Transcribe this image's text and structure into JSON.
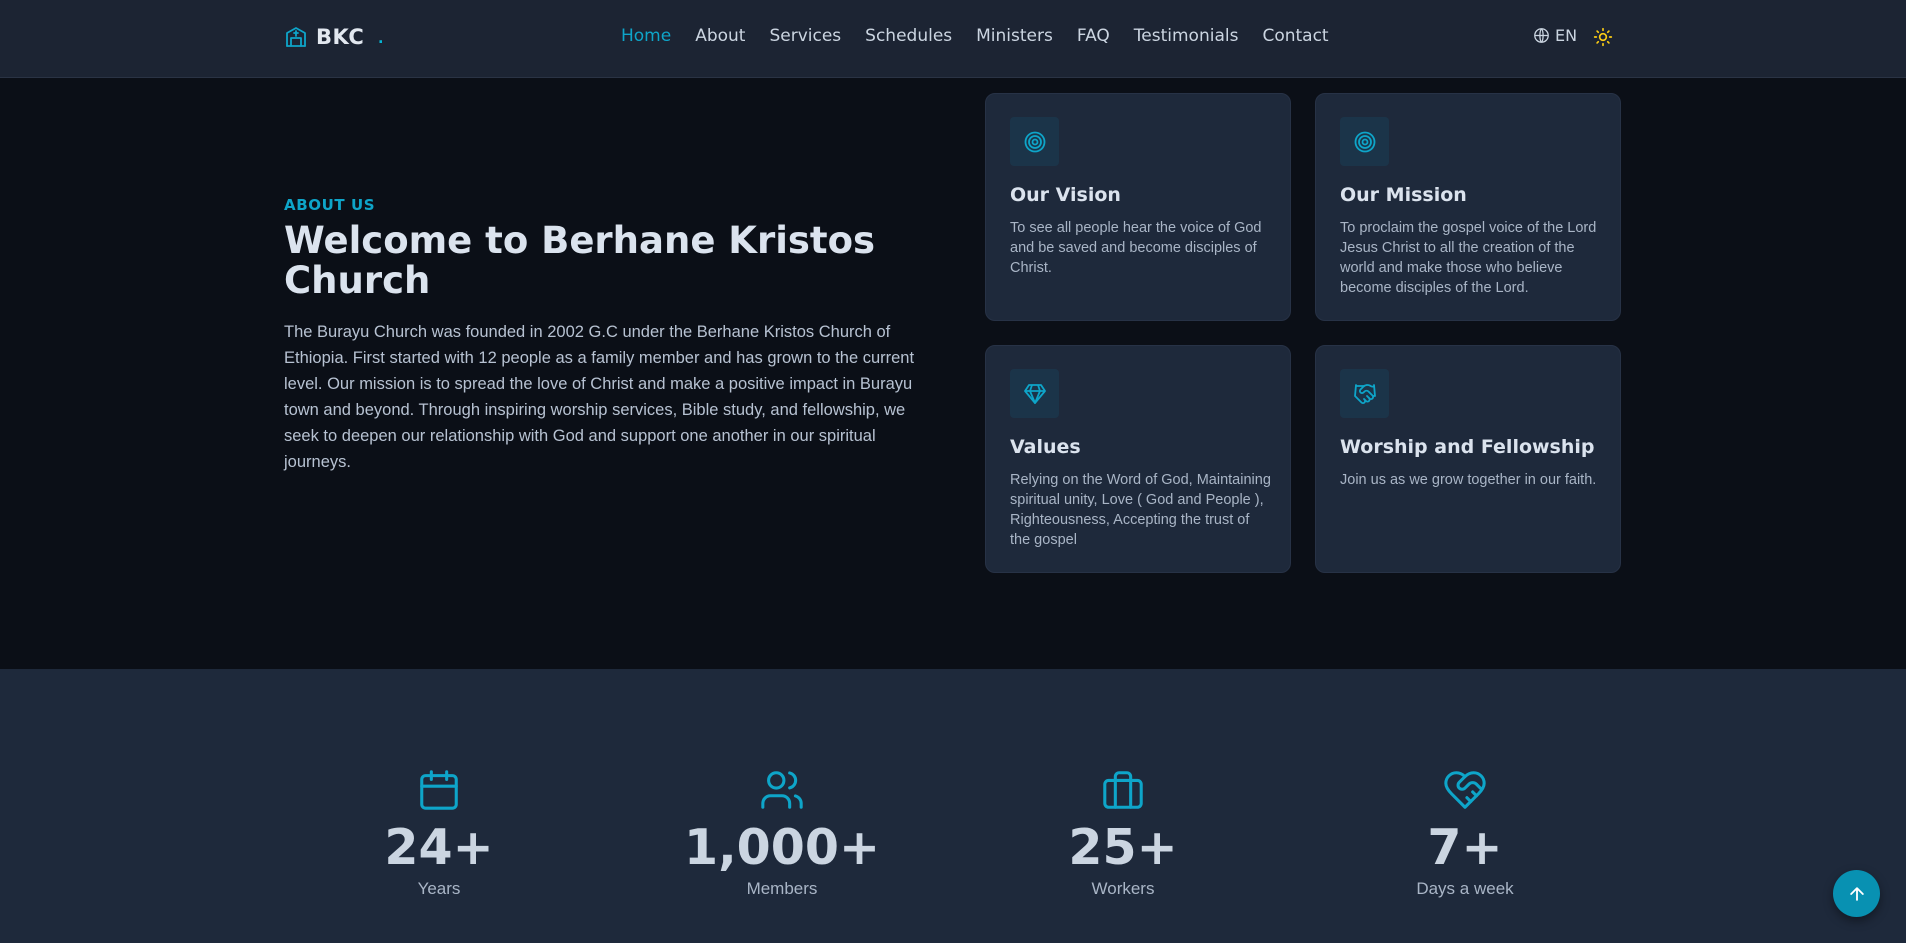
{
  "brand": {
    "name": "BKC",
    "dot": "."
  },
  "nav": {
    "items": [
      "Home",
      "About",
      "Services",
      "Schedules",
      "Ministers",
      "FAQ",
      "Testimonials",
      "Contact"
    ],
    "active": "Home"
  },
  "language": {
    "label": "EN"
  },
  "about": {
    "eyebrow": "ABOUT US",
    "title": "Welcome to Berhane Kristos Church",
    "text": "The Burayu Church was founded in 2002 G.C under the Berhane Kristos Church of Ethiopia. First started with 12 people as a family member and has grown to the current level. Our mission is to spread the love of Christ and make a positive impact in Burayu town and beyond. Through inspiring worship services, Bible study, and fellowship, we seek to deepen our relationship with God and support one another in our spiritual journeys."
  },
  "cards": [
    {
      "icon": "target-icon",
      "title": "Our Vision",
      "text": "To see all people hear the voice of God and be saved and become disciples of Christ."
    },
    {
      "icon": "target-icon",
      "title": "Our Mission",
      "text": "To proclaim the gospel voice of the Lord Jesus Christ to all the creation of the world and make those who believe become disciples of the Lord."
    },
    {
      "icon": "diamond-icon",
      "title": "Values",
      "text": "Relying on the Word of God, Maintaining spiritual unity, Love ( God and People ), Righteousness, Accepting the trust of the gospel"
    },
    {
      "icon": "handshake-icon",
      "title": "Worship and Fellowship",
      "text": "Join us as we grow together in our faith."
    }
  ],
  "stats": [
    {
      "icon": "calendar-icon",
      "value": "24+",
      "label": "Years"
    },
    {
      "icon": "users-icon",
      "value": "1,000+",
      "label": "Members"
    },
    {
      "icon": "briefcase-icon",
      "value": "25+",
      "label": "Workers"
    },
    {
      "icon": "heart-handshake-icon",
      "value": "7+",
      "label": "Days a week"
    }
  ],
  "colors": {
    "accent": "#0ea5c9",
    "header_bg": "#1c2433",
    "page_bg": "#0b0f17",
    "card_bg": "#1e293b",
    "sun_icon": "#facc15"
  }
}
